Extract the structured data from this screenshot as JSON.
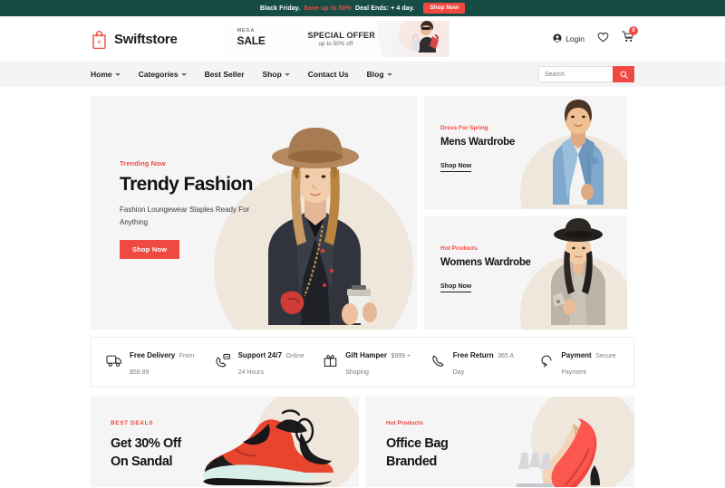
{
  "topbar": {
    "text_before": "Black Friday.",
    "accent": "Save up to 50%",
    "text_after": "Deal Ends: + 4 day.",
    "button": "Shop Now",
    "bg_color": "#174c44",
    "accent_color": "#ef4a42"
  },
  "header": {
    "brand": "Swiftstore",
    "brand_icon": "shopping-bag-icon",
    "promo": {
      "mega": "MEGA",
      "sale": "SALE",
      "offer": "SPECIAL OFFER",
      "subtitle": "up to 50% off"
    },
    "login_label": "Login",
    "login_icon": "user-icon",
    "wishlist_icon": "heart-icon",
    "cart_icon": "cart-icon",
    "cart_count": "0"
  },
  "nav": {
    "items": [
      {
        "label": "Home",
        "has_dropdown": true
      },
      {
        "label": "Categories",
        "has_dropdown": true
      },
      {
        "label": "Best Seller",
        "has_dropdown": false
      },
      {
        "label": "Shop",
        "has_dropdown": true
      },
      {
        "label": "Contact Us",
        "has_dropdown": false
      },
      {
        "label": "Blog",
        "has_dropdown": true
      }
    ],
    "search_placeholder": "Search",
    "search_icon": "search-icon",
    "search_button_color": "#ef4a42"
  },
  "hero": {
    "eyebrow": "Trending Now",
    "title": "Trendy Fashion",
    "subtitle": "Fashion Loungewear Staples Ready For Anything",
    "button": "Shop Now"
  },
  "side_cards": [
    {
      "eyebrow": "Dress For Spring",
      "title": "Mens Wardrobe",
      "link": "Shop Now"
    },
    {
      "eyebrow": "Hot Products",
      "title": "Womens Wardrobe",
      "link": "Shop Now"
    }
  ],
  "features": [
    {
      "icon": "truck-icon",
      "title": "Free Delivery",
      "subtitle": "From $59.89"
    },
    {
      "icon": "headset-icon",
      "title": "Support 24/7",
      "subtitle": "Online 24 Hours"
    },
    {
      "icon": "gift-icon",
      "title": "Gift Hamper",
      "subtitle": "$999 + Shoping"
    },
    {
      "icon": "phone-icon",
      "title": "Free Return",
      "subtitle": "365 A Day"
    },
    {
      "icon": "refresh-icon",
      "title": "Payment",
      "subtitle": "Secure Payment"
    }
  ],
  "promo_cards": [
    {
      "eyebrow": "BEST DEALS",
      "title_line1": "Get 30% Off",
      "title_line2": "On Sandal"
    },
    {
      "eyebrow": "Hot Products",
      "title_line1": "Office Bag",
      "title_line2": "Branded"
    }
  ]
}
